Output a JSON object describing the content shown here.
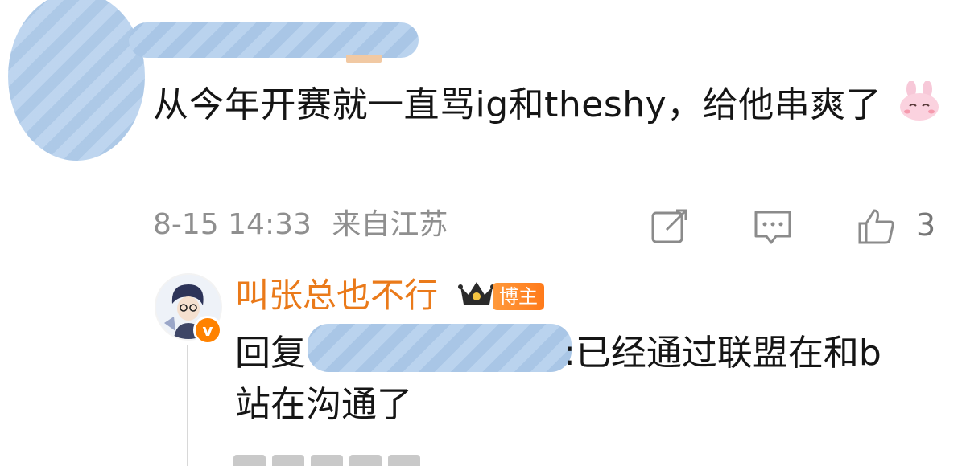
{
  "comment": {
    "text": "从今年开赛就一直骂ig和theshy，给他串爽了",
    "emoji_icon": "pink-bunny-emoji",
    "timestamp": "8-15 14:33",
    "location": "来自江苏",
    "likes": "3",
    "icons": [
      "share-icon",
      "comment-icon",
      "like-icon"
    ]
  },
  "reply": {
    "author": "叫张总也不行",
    "badge": "博主",
    "prefix": "回复",
    "text_line1": ":已经通过联盟在和b",
    "text_line2": "站在沟通了",
    "icons": [
      "avatar",
      "verified-icon",
      "crown-icon"
    ]
  },
  "colors": {
    "author_orange": "#ea7a1a",
    "badge_orange": "#ff8200",
    "meta_gray": "#8f8f8f",
    "redaction_blue": "#a9c6e6"
  }
}
